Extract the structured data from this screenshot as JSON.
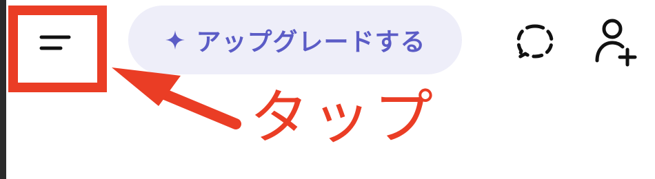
{
  "header": {
    "menu_icon": "menu-lines-icon",
    "upgrade_button": {
      "icon": "sparkle-icon",
      "label": "アップグレードする"
    },
    "temporary_chat_icon": "dashed-chat-bubble-icon",
    "add_user_icon": "add-user-icon"
  },
  "annotation": {
    "label": "タップ",
    "arrow_icon": "arrow-icon"
  },
  "colors": {
    "annotation_red": "#ea3d25",
    "pill_background": "#eeeef9",
    "accent_purple": "#5b5cc6",
    "icon_dark": "#111111"
  }
}
